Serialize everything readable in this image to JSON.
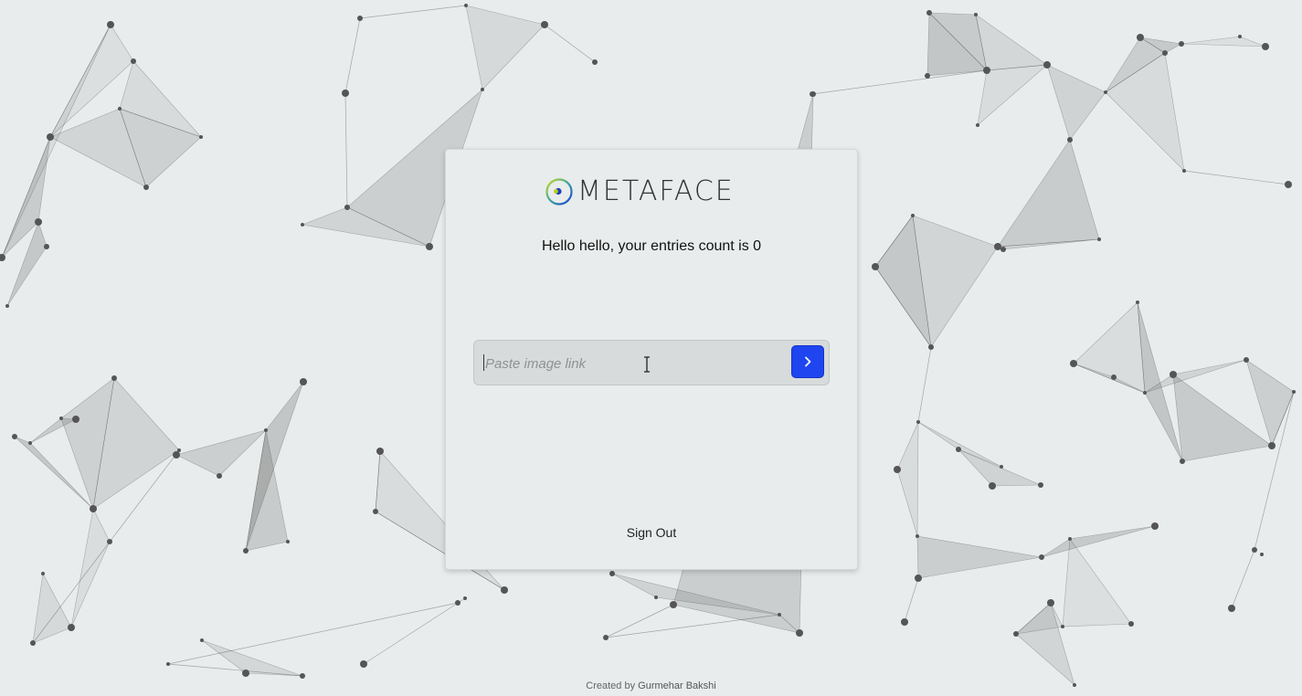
{
  "app": {
    "brand_name": "METAFACE",
    "brand_colors": {
      "ring_start": "#c9d81a",
      "ring_end": "#1a3fd4",
      "dot": "#1d3fb8"
    }
  },
  "greeting": "Hello hello, your entries count is 0",
  "image_form": {
    "placeholder": "Paste image link",
    "value": "",
    "submit_icon": "chevron-right-icon",
    "submit_color": "#1f45f0"
  },
  "nav": {
    "signout_label": "Sign Out"
  },
  "footer": {
    "prefix": "Created by ",
    "author": "Gurmehar Bakshi"
  }
}
